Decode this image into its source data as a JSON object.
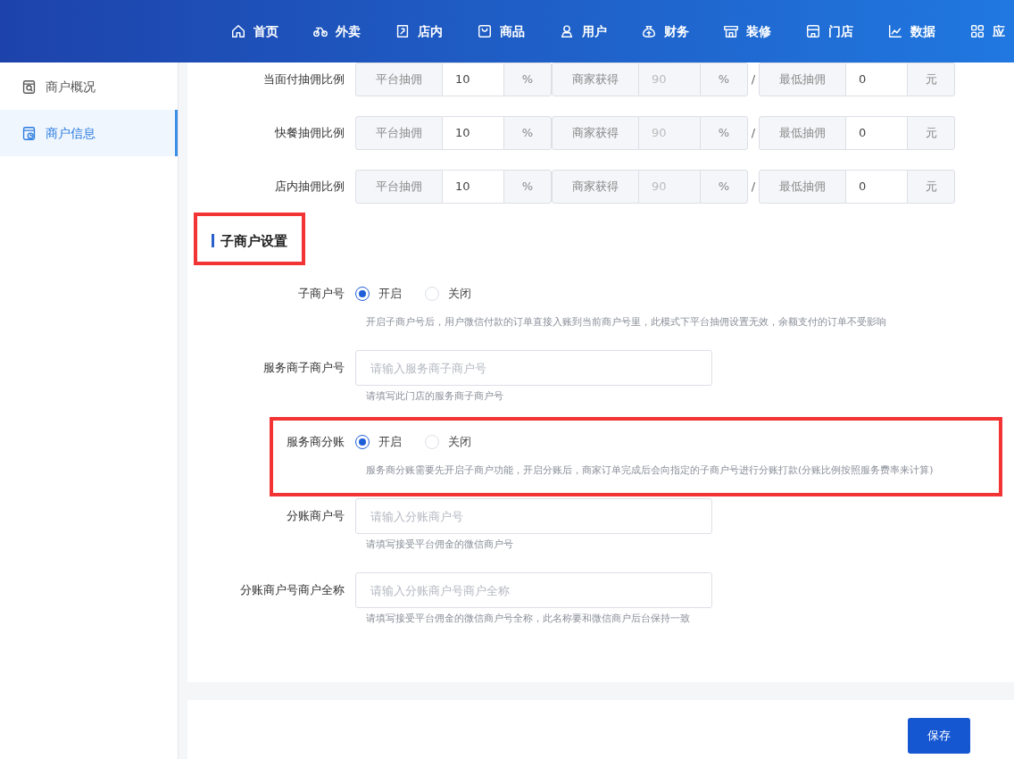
{
  "nav": [
    {
      "label": "首页"
    },
    {
      "label": "外卖"
    },
    {
      "label": "店内"
    },
    {
      "label": "商品"
    },
    {
      "label": "用户"
    },
    {
      "label": "财务"
    },
    {
      "label": "装修"
    },
    {
      "label": "门店"
    },
    {
      "label": "数据"
    },
    {
      "label": "应"
    }
  ],
  "sidebar": {
    "items": [
      {
        "label": "商户概况",
        "selected": false
      },
      {
        "label": "商户信息",
        "selected": true
      }
    ]
  },
  "commission_rows": [
    {
      "label": "当面付抽佣比例",
      "separator": "/",
      "groups": [
        {
          "label": "平台抽佣",
          "value": "10",
          "unit": "%",
          "disabled": false
        },
        {
          "label": "商家获得",
          "value": "90",
          "unit": "%",
          "disabled": true
        },
        {
          "label": "最低抽佣",
          "value": "0",
          "unit": "元",
          "disabled": false
        }
      ]
    },
    {
      "label": "快餐抽佣比例",
      "separator": "/",
      "groups": [
        {
          "label": "平台抽佣",
          "value": "10",
          "unit": "%",
          "disabled": false
        },
        {
          "label": "商家获得",
          "value": "90",
          "unit": "%",
          "disabled": true
        },
        {
          "label": "最低抽佣",
          "value": "0",
          "unit": "元",
          "disabled": false
        }
      ]
    },
    {
      "label": "店内抽佣比例",
      "separator": "/",
      "groups": [
        {
          "label": "平台抽佣",
          "value": "10",
          "unit": "%",
          "disabled": false
        },
        {
          "label": "商家获得",
          "value": "90",
          "unit": "%",
          "disabled": true
        },
        {
          "label": "最低抽佣",
          "value": "0",
          "unit": "元",
          "disabled": false
        }
      ]
    }
  ],
  "section": {
    "title": "子商户设置",
    "highlighted": true
  },
  "fields": [
    {
      "kind": "radio",
      "label": "子商户号",
      "options": [
        {
          "label": "开启",
          "selected": true
        },
        {
          "label": "关闭",
          "selected": false
        }
      ],
      "help": "开启子商户号后，用户微信付款的订单直接入账到当前商户号里，此模式下平台抽佣设置无效，余额支付的订单不受影响",
      "highlighted": false
    },
    {
      "kind": "text",
      "label": "服务商子商户号",
      "placeholder": "请输入服务商子商户号",
      "help": "请填写此门店的服务商子商户号"
    },
    {
      "kind": "radio",
      "label": "服务商分账",
      "options": [
        {
          "label": "开启",
          "selected": true
        },
        {
          "label": "关闭",
          "selected": false
        }
      ],
      "help": "服务商分账需要先开启子商户功能，开启分账后，商家订单完成后会向指定的子商户号进行分账打款(分账比例按照服务费率来计算)",
      "highlighted": true
    },
    {
      "kind": "text",
      "label": "分账商户号",
      "placeholder": "请输入分账商户号",
      "help": "请填写接受平台佣金的微信商户号"
    },
    {
      "kind": "text",
      "label": "分账商户号商户全称",
      "placeholder": "请输入分账商户号商户全称",
      "help": "请填写接受平台佣金的微信商户号全称，此名称要和微信商户后台保持一致"
    }
  ],
  "save_button": "保存"
}
